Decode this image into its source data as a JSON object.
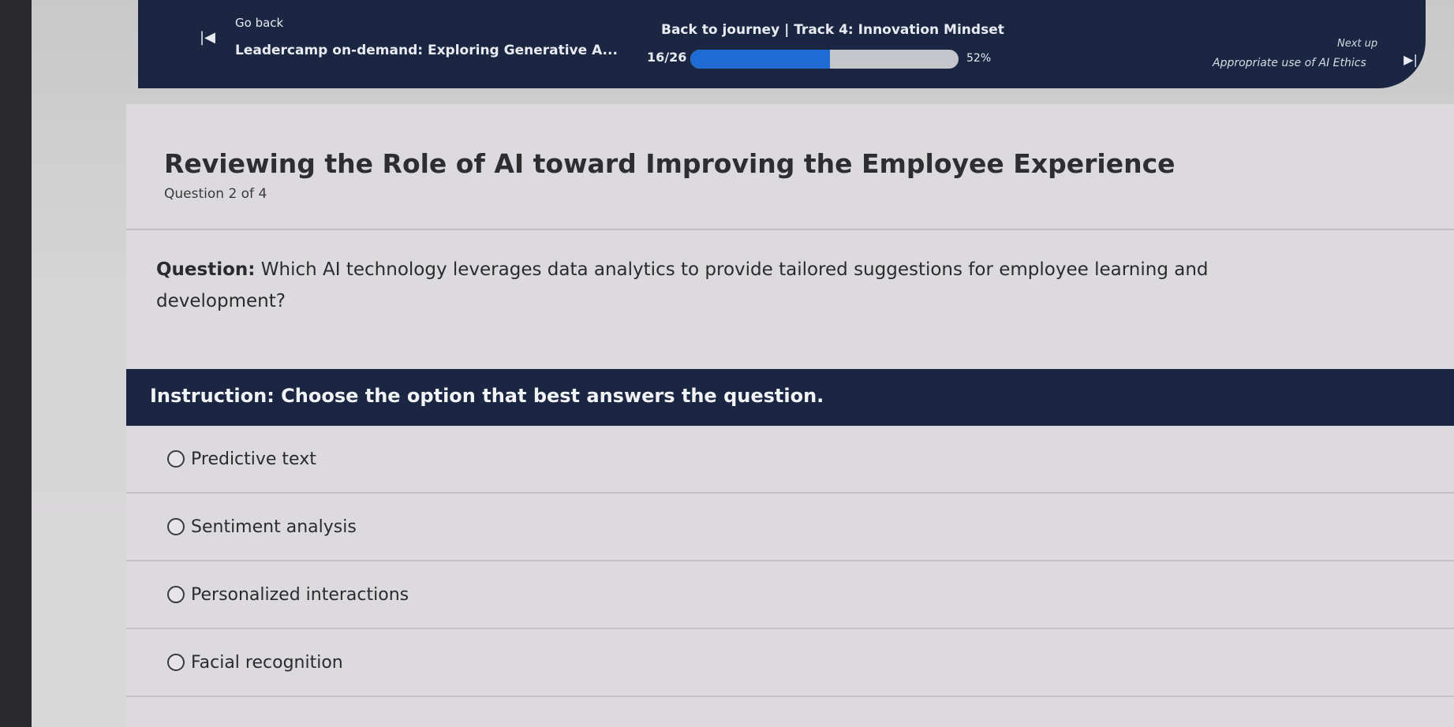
{
  "header": {
    "go_back_label": "Go back",
    "course_title": "Leadercamp on-demand: Exploring Generative A...",
    "journey_link": "Back to journey | Track 4: Innovation Mindset",
    "progress_count": "16/26",
    "progress_percent_label": "52%",
    "progress_fraction": 0.52,
    "next_up_label": "Next up",
    "next_up_title": "Appropriate use of AI Ethics",
    "icons": {
      "back": "skip-back-icon",
      "next": "skip-forward-icon"
    }
  },
  "lesson": {
    "title": "Reviewing the Role of AI toward Improving the Employee Experience",
    "question_number": "Question 2 of 4",
    "question_prefix": "Question:",
    "question_body": " Which AI technology leverages data analytics to provide tailored suggestions for employee learning and development?",
    "instruction": "Instruction: Choose the option that best answers the question."
  },
  "options": [
    {
      "label": "Predictive text"
    },
    {
      "label": "Sentiment analysis"
    },
    {
      "label": "Personalized interactions"
    },
    {
      "label": "Facial recognition"
    }
  ],
  "colors": {
    "header_bg": "#1b2742",
    "progress_fill": "#1f6bd4",
    "card_bg": "#dcdadc"
  }
}
